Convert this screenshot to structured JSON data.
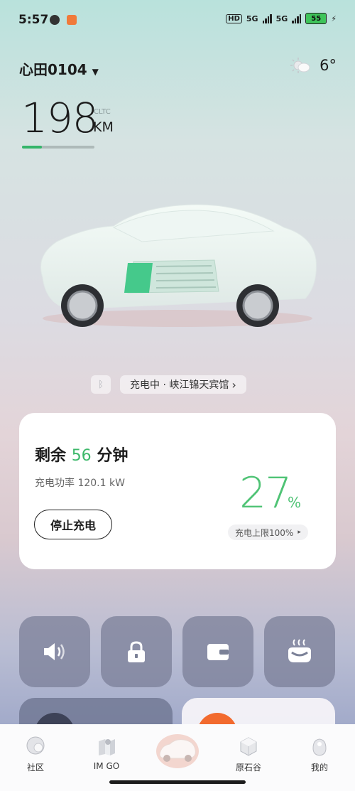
{
  "status_bar": {
    "time": "5:57",
    "hd": "HD",
    "net1": "5G",
    "net2": "5G",
    "battery": "55"
  },
  "header": {
    "car_name": "心田0104",
    "temperature": "6°",
    "weather_icon": "partly-cloudy-icon"
  },
  "range": {
    "value": "198",
    "standard": "CLTC",
    "unit": "KM",
    "level": 0.27
  },
  "location": {
    "text": "充电中 · 峡江锦天宾馆",
    "chevron": "›"
  },
  "charging": {
    "remain_prefix": "剩余",
    "remain_minutes": "56",
    "remain_suffix": "分钟",
    "power_text": "充电功率 120.1 kW",
    "stop_label": "停止充电",
    "percent": "27",
    "percent_sign": "%",
    "limit_text": "充电上限100%",
    "limit_arrow": "▸"
  },
  "controls": [
    "speaker-icon",
    "lock-icon",
    "wallet-icon",
    "seat-heat-icon"
  ],
  "nav": {
    "items": [
      {
        "label": "社区",
        "icon": "community-icon"
      },
      {
        "label": "IM GO",
        "icon": "imgo-icon"
      },
      {
        "label": "",
        "icon": "car-home-icon"
      },
      {
        "label": "原石谷",
        "icon": "stone-valley-icon"
      },
      {
        "label": "我的",
        "icon": "profile-icon"
      }
    ]
  },
  "colors": {
    "accent_green": "#4fc375",
    "orange": "#f26a2e"
  }
}
